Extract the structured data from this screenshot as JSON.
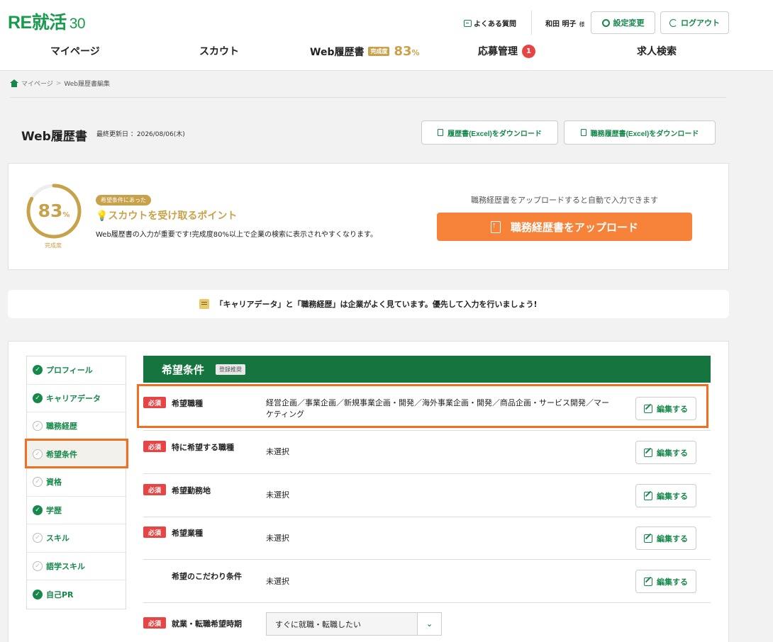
{
  "header": {
    "logo_text": "RE就活",
    "logo_num": "30",
    "faq": "よくある質問",
    "user_name": "和田 明子",
    "user_suffix": "様",
    "settings": "設定変更",
    "logout": "ログアウト"
  },
  "nav": {
    "mypage": "マイページ",
    "scout": "スカウト",
    "resume": "Web履歴書",
    "resume_badge": "完成度",
    "resume_pct": "83",
    "pct_unit": "%",
    "applications": "応募管理",
    "applications_count": "1",
    "jobs": "求人検索"
  },
  "breadcrumb": {
    "home": "マイページ",
    "sep": ">",
    "current": "Web履歴書編集"
  },
  "page": {
    "title": "Web履歴書",
    "updated_label": "最終更新日 ：2026/08/06(木)",
    "dl_resume": "履歴書(Excel)をダウンロード",
    "dl_career": "職務履歴書(Excel)をダウンロード"
  },
  "completion": {
    "percent": 83,
    "percent_text": "83",
    "unit": "%",
    "label": "完成度",
    "pill": "希望条件にあった",
    "tip_title": "💡スカウトを受け取るポイント",
    "tip_desc": "Web履歴書の入力が重要です!完成度80%以上で企業の検索に表示されやすくなります。",
    "upload_note": "職務経歴書をアップロードすると自動で入力できます",
    "upload_button": "職務経歴書をアップロード"
  },
  "banner": {
    "text": "「キャリアデータ」と「職務経歴」は企業がよく見ています。優先して入力を行いましょう!"
  },
  "sidebar": {
    "items": [
      {
        "label": "プロフィール",
        "done": true
      },
      {
        "label": "キャリアデータ",
        "done": true
      },
      {
        "label": "職務経歴",
        "done": false
      },
      {
        "label": "希望条件",
        "done": false
      },
      {
        "label": "資格",
        "done": false
      },
      {
        "label": "学歴",
        "done": true
      },
      {
        "label": "スキル",
        "done": false
      },
      {
        "label": "語学スキル",
        "done": false
      },
      {
        "label": "自己PR",
        "done": true
      }
    ]
  },
  "section": {
    "title": "希望条件",
    "tag": "登録推奨",
    "required_label": "必須",
    "edit_label": "編集する",
    "rows": [
      {
        "label": "希望職種",
        "required": true,
        "value_line1": "経営企画／事業企画／新規事業企画・開発／海外事業企画・開発／商品企画・サービス開発／マー",
        "value_line2": "ケティング"
      },
      {
        "label": "特に希望する職種",
        "required": true,
        "value_line1": "未選択",
        "value_line2": ""
      },
      {
        "label": "希望勤務地",
        "required": true,
        "value_line1": "未選択",
        "value_line2": ""
      },
      {
        "label": "希望業種",
        "required": true,
        "value_line1": "未選択",
        "value_line2": ""
      },
      {
        "label": "希望のこだわり条件",
        "required": false,
        "value_line1": "未選択",
        "value_line2": ""
      }
    ],
    "timing_label": "就業・転職希望時期",
    "timing_value": "すぐに就職・転職したい"
  },
  "colors": {
    "brand_green": "#16884a",
    "header_green": "#16743f",
    "gold": "#c8a24a",
    "orange": "#f7823a",
    "highlight": "#f26f1f",
    "required_red": "#e64545"
  }
}
